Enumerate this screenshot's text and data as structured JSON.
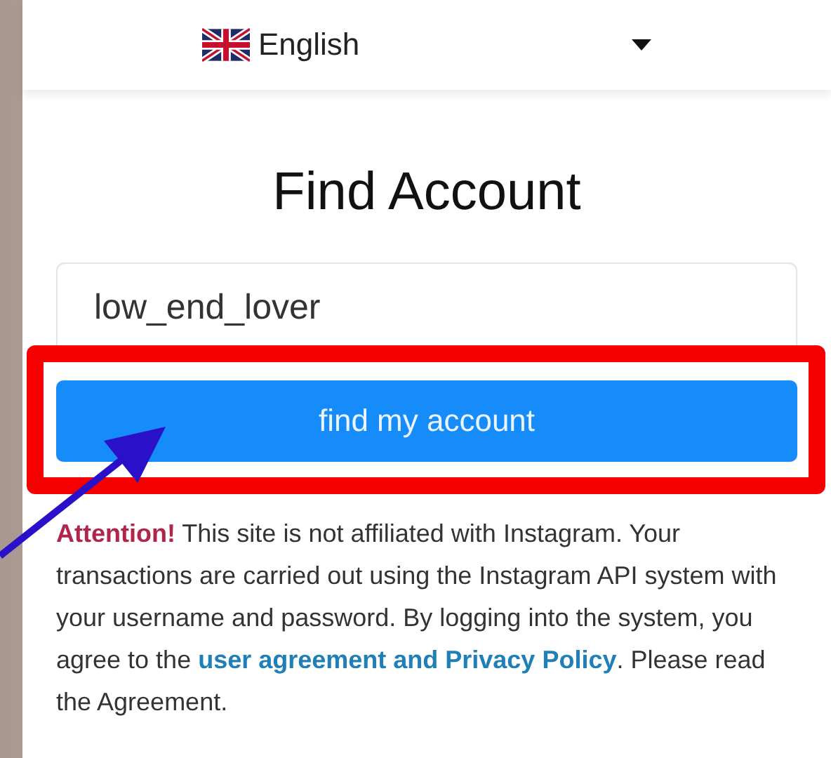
{
  "language_select": {
    "value": "English"
  },
  "title": "Find Account",
  "username_field": {
    "value": "low_end_lover"
  },
  "submit_button": "find my account",
  "notice": {
    "lead": "Attention!",
    "text_before": "This site is not affiliated with Instagram. Your transactions are carried out using the Instagram API system with your username and password. By logging into the system, you agree to the ",
    "link": "user agreement and Privacy Policy",
    "text_after": ". Please read the Agreement."
  }
}
